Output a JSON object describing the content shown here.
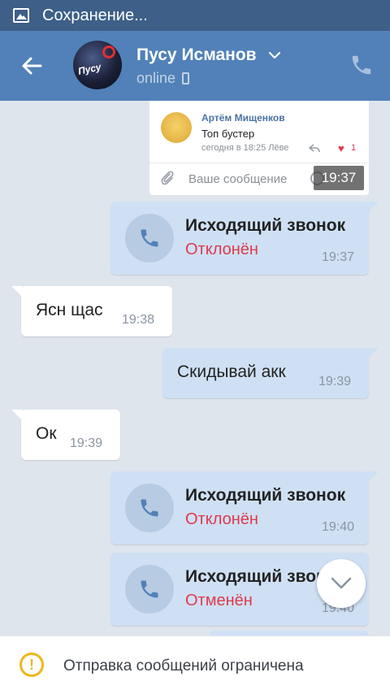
{
  "status_bar": {
    "text": "Сохранение..."
  },
  "header": {
    "contact_name": "Пусу Исманов",
    "presence": "online",
    "avatar_text": "Пусу\nбустер"
  },
  "notification": {
    "author": "Артём Мищенков",
    "message": "Топ бустер",
    "time": "сегодня в 18:25 Лёве",
    "likes": "1",
    "input_placeholder": "Ваше сообщение",
    "overlay_time": "19:37"
  },
  "messages": [
    {
      "type": "call",
      "direction": "out",
      "title": "Исходящий звонок",
      "status": "Отклонён",
      "time": "19:37"
    },
    {
      "type": "text",
      "direction": "in",
      "text": "Ясн щас",
      "time": "19:38"
    },
    {
      "type": "text",
      "direction": "out",
      "text": "Скидывай акк",
      "time": "19:39"
    },
    {
      "type": "text",
      "direction": "in",
      "text": "Ок",
      "time": "19:39"
    },
    {
      "type": "call",
      "direction": "out",
      "title": "Исходящий звонок",
      "status": "Отклонён",
      "time": "19:40"
    },
    {
      "type": "call",
      "direction": "out",
      "title": "Исходящий звон",
      "status": "Отменён",
      "time": "19:40"
    }
  ],
  "bottom_bar": {
    "text": "Отправка сообщений ограничена",
    "warning_symbol": "!"
  },
  "colors": {
    "header": "#5181b8",
    "status_bar": "#3d5f88",
    "outgoing_bubble": "#cfe0f4",
    "incoming_bubble": "#ffffff",
    "declined": "#e0394b",
    "warning": "#f2b51a"
  },
  "icons": [
    "image-icon",
    "back-arrow-icon",
    "chevron-down-icon",
    "mobile-icon",
    "phone-icon",
    "reply-icon",
    "heart-icon",
    "paperclip-icon",
    "emoji-icon",
    "phone-handset-icon",
    "chevron-down-icon",
    "warning-icon"
  ]
}
